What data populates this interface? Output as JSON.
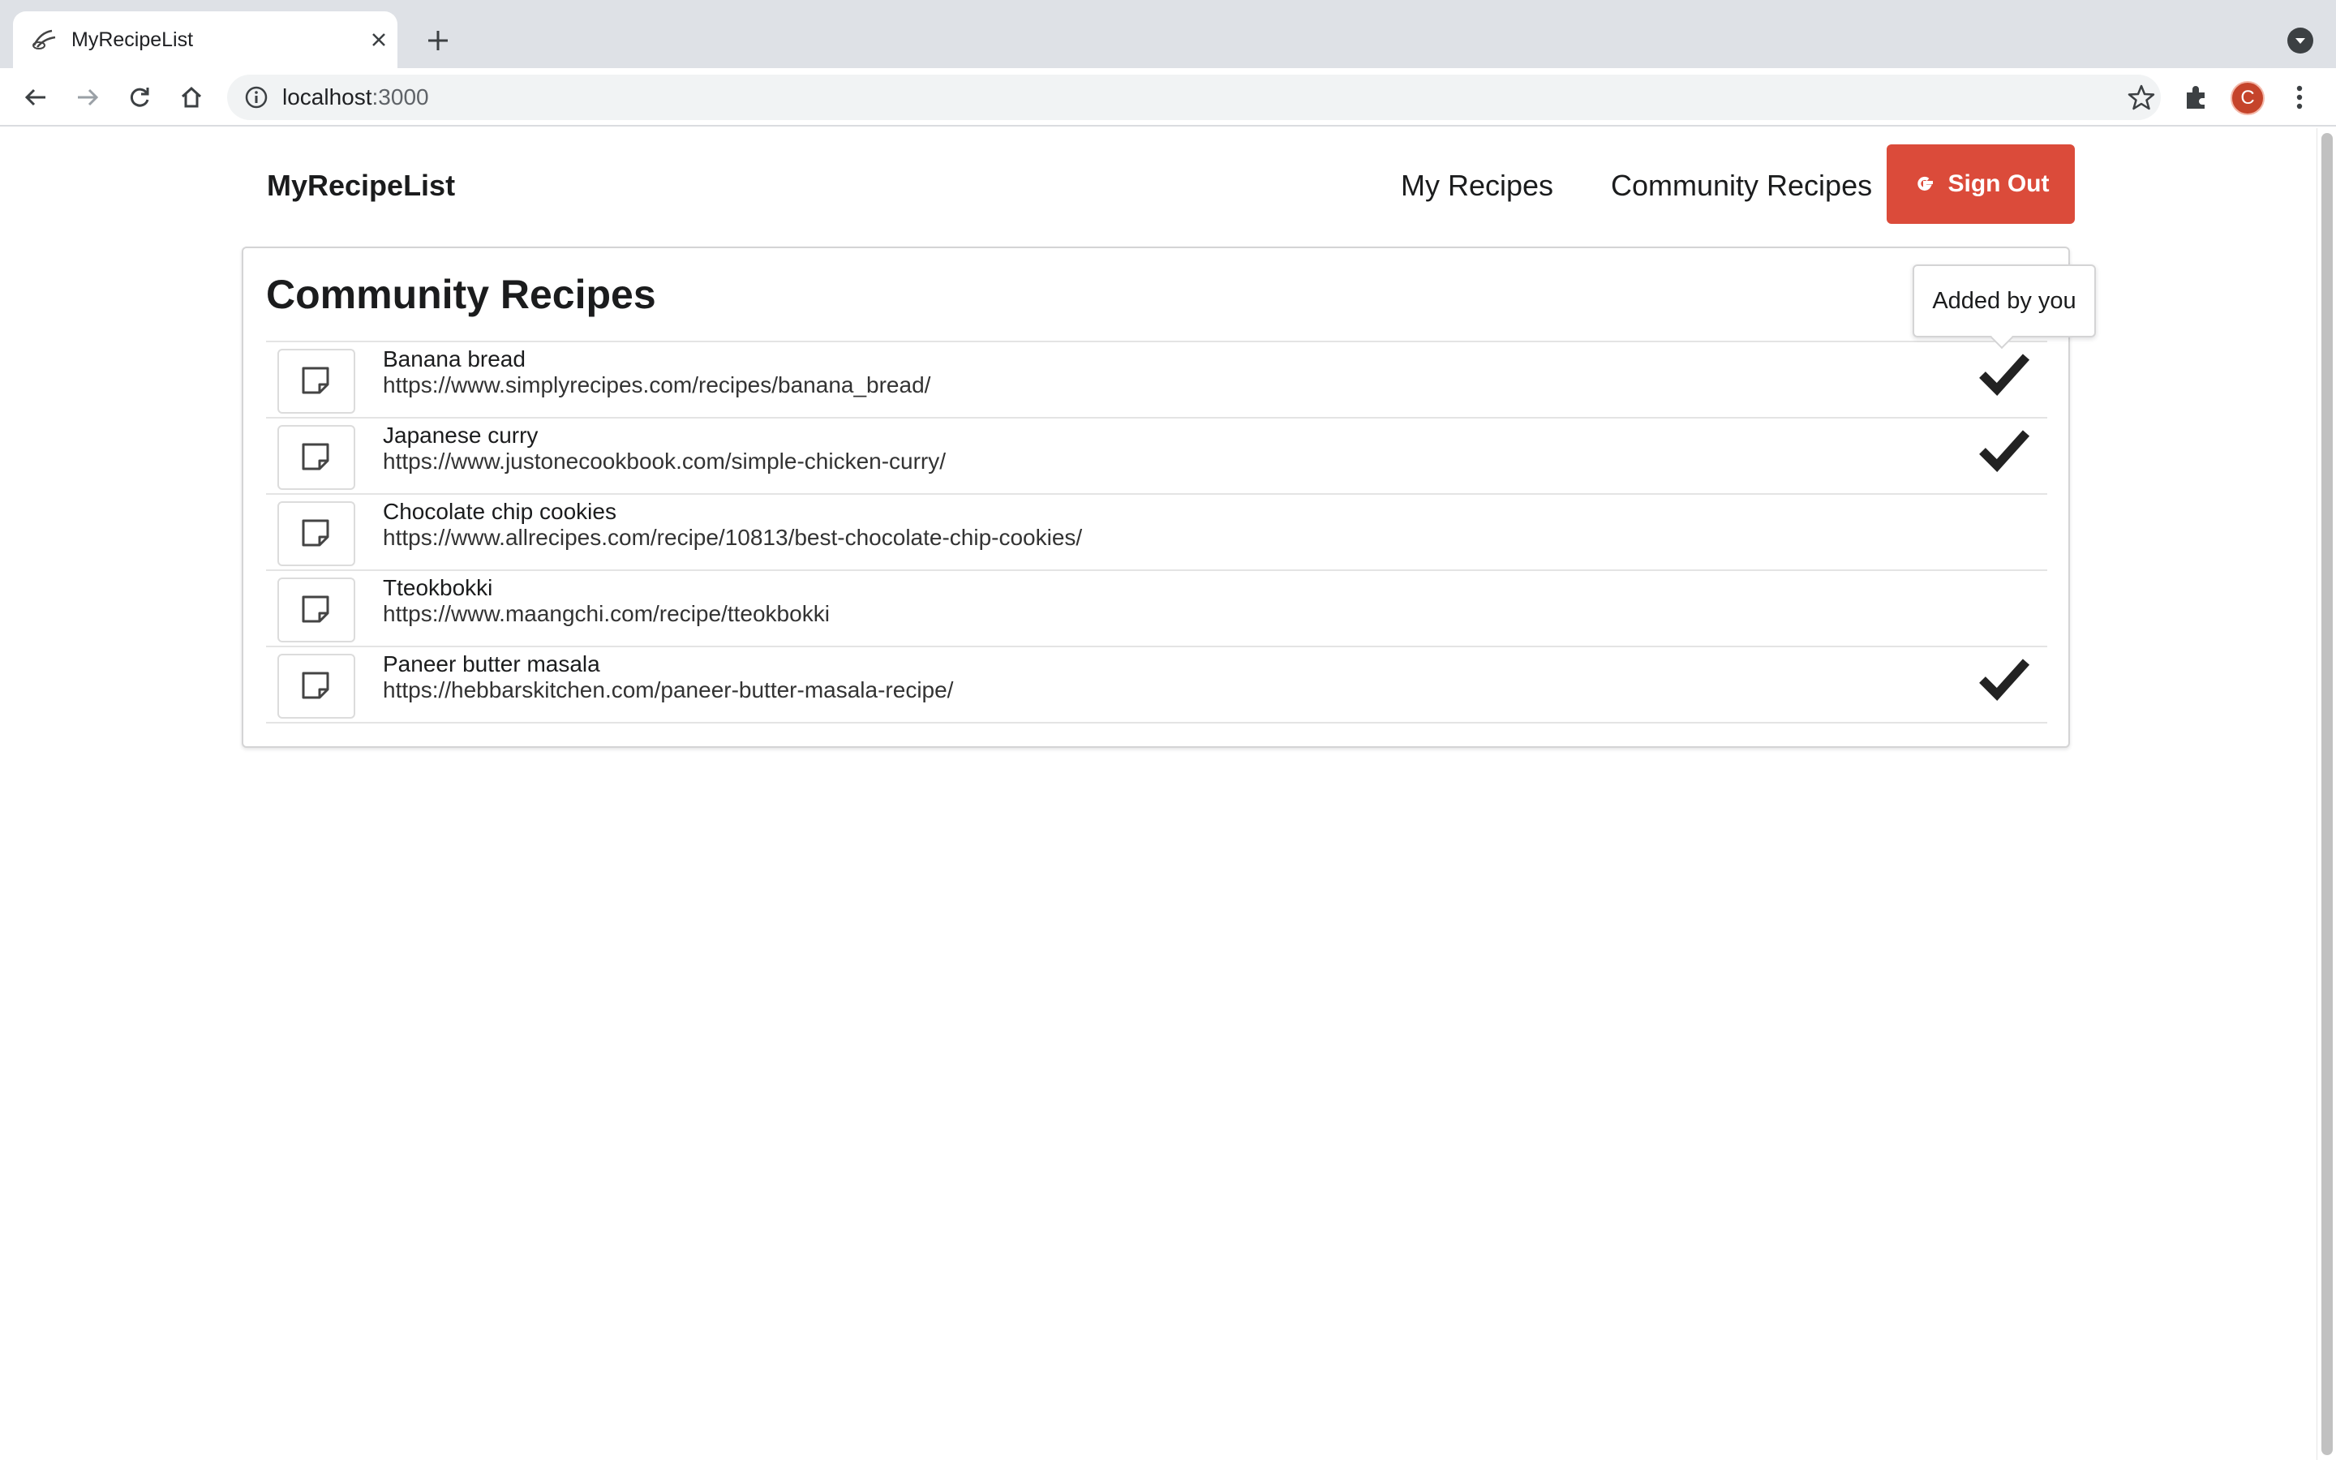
{
  "browser": {
    "tab_title": "MyRecipeList",
    "url_host": "localhost",
    "url_port": ":3000",
    "profile_initial": "C"
  },
  "app": {
    "brand": "MyRecipeList",
    "nav": {
      "my_recipes": "My Recipes",
      "community_recipes": "Community Recipes",
      "sign_out": "Sign Out",
      "sign_out_icon": "G"
    },
    "colors": {
      "sign_out_bg": "#db4b3a"
    }
  },
  "main": {
    "title": "Community Recipes",
    "tooltip": "Added by you",
    "recipes": [
      {
        "name": "Banana bread",
        "url": "https://www.simplyrecipes.com/recipes/banana_bread/",
        "added_by_you": true
      },
      {
        "name": "Japanese curry",
        "url": "https://www.justonecookbook.com/simple-chicken-curry/",
        "added_by_you": true
      },
      {
        "name": "Chocolate chip cookies",
        "url": "https://www.allrecipes.com/recipe/10813/best-chocolate-chip-cookies/",
        "added_by_you": false
      },
      {
        "name": "Tteokbokki",
        "url": "https://www.maangchi.com/recipe/tteokbokki",
        "added_by_you": false
      },
      {
        "name": "Paneer butter masala",
        "url": "https://hebbarskitchen.com/paneer-butter-masala-recipe/",
        "added_by_you": true
      }
    ]
  }
}
